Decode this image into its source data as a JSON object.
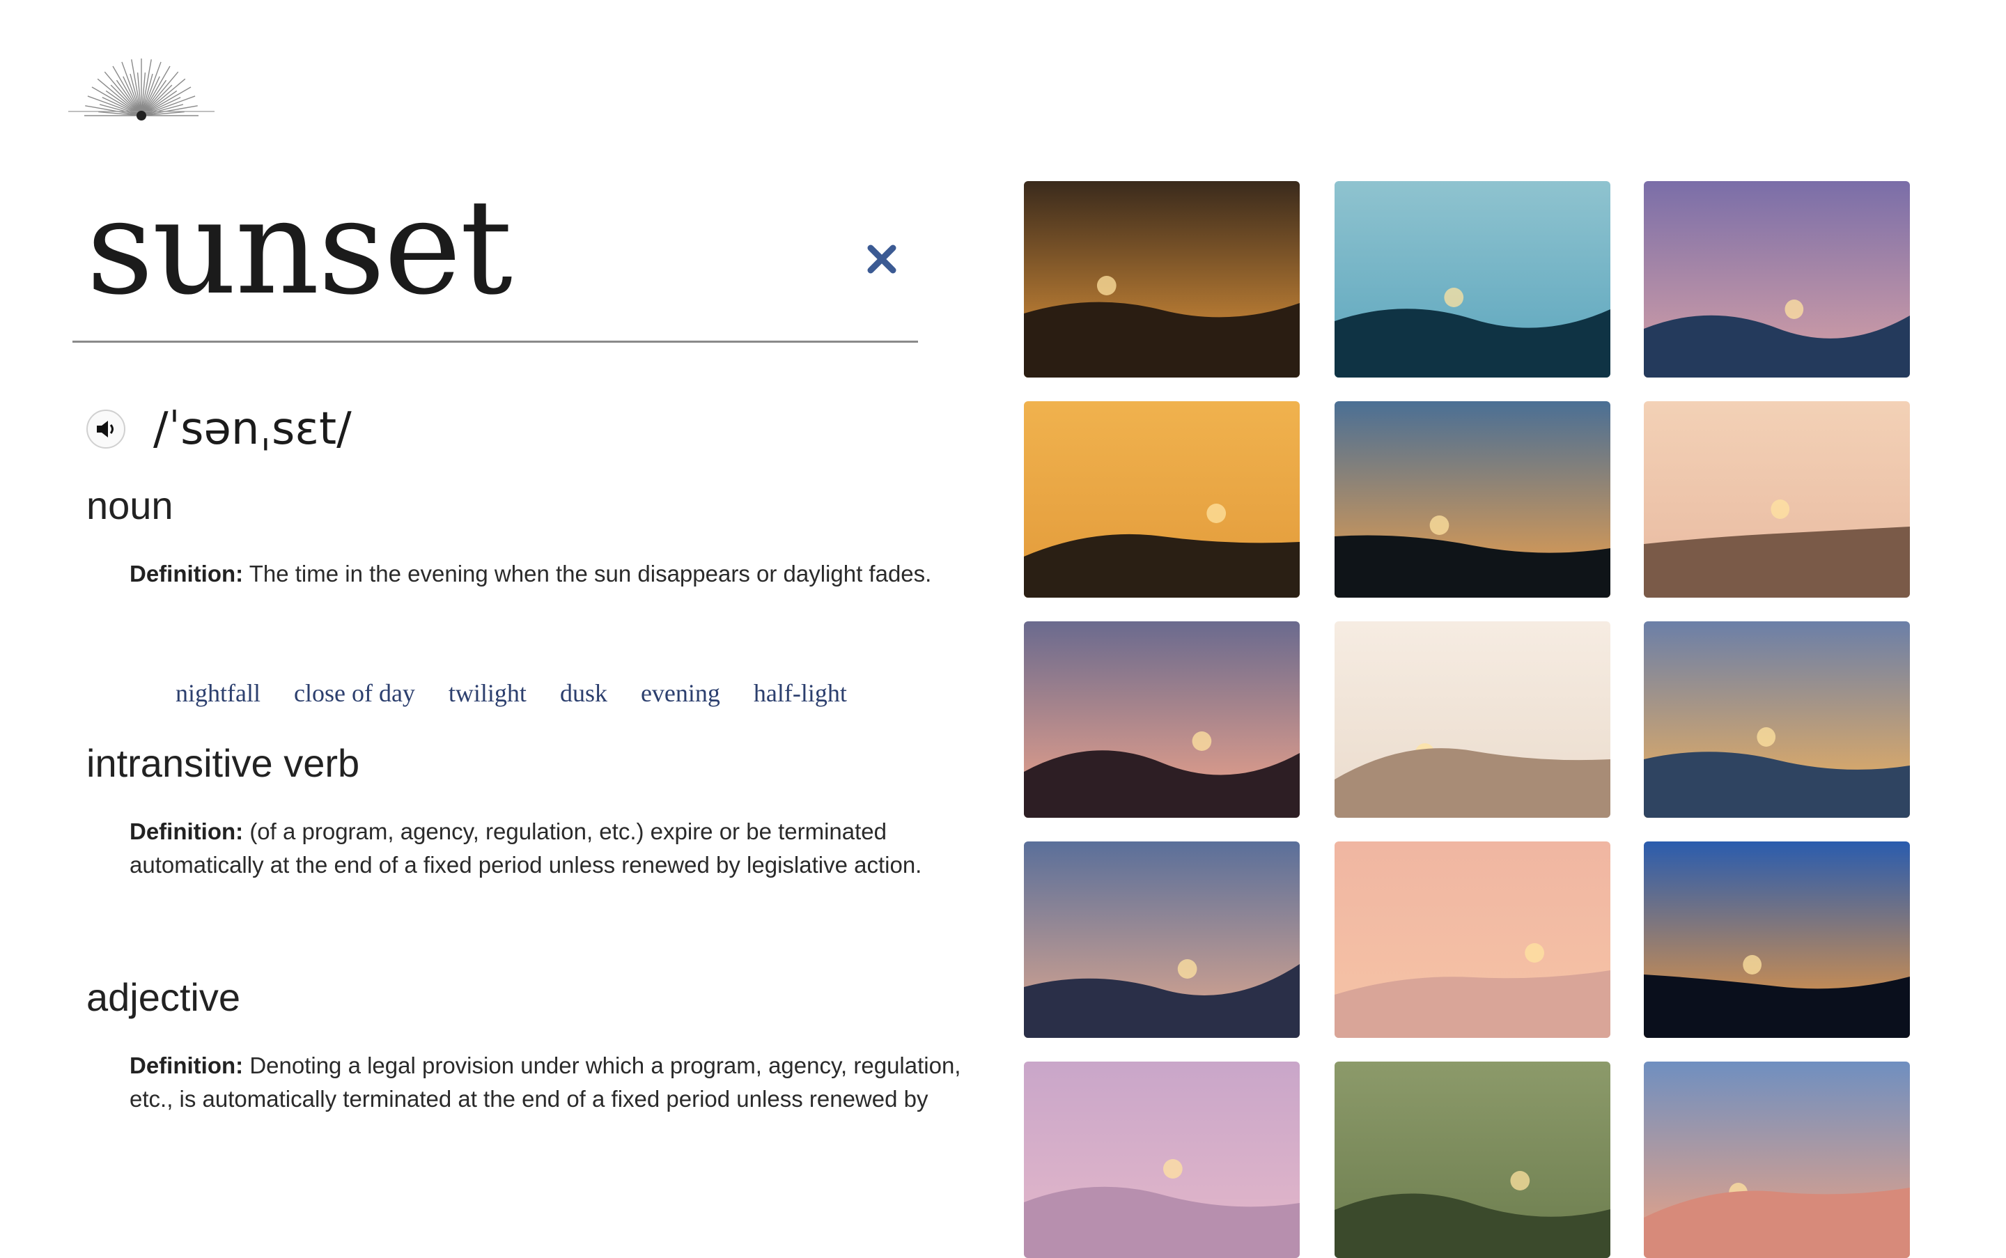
{
  "logo": {
    "icon": "sunburst-icon"
  },
  "search": {
    "term": "sunset",
    "clear_icon": "close-icon"
  },
  "pronunciation": {
    "icon": "speaker-icon",
    "phonetic": "/ˈsənˌsɛt/"
  },
  "senses": [
    {
      "part_of_speech": "noun",
      "definition_label": "Definition:",
      "definition": "The time in the evening when the sun disappears or daylight fades.",
      "synonyms": [
        "nightfall",
        "close of day",
        "twilight",
        "dusk",
        "evening",
        "half-light"
      ]
    },
    {
      "part_of_speech": "intransitive verb",
      "definition_label": "Definition:",
      "definition_line1": "(of a program, agency, regulation, etc.) expire or be terminated",
      "definition_line2": "automatically at the end of a fixed period unless renewed by legislative action."
    },
    {
      "part_of_speech": "adjective",
      "definition_label": "Definition:",
      "definition_line1": "Denoting a legal provision under which a program, agency, regulation,",
      "definition_line2": "etc., is automatically terminated at the end of a fixed period unless renewed by"
    }
  ],
  "images": [
    {
      "name": "splash-silhouette",
      "sky_top": "#3a2a1c",
      "sky_bottom": "#e89a3c",
      "ground": "#2a1d12"
    },
    {
      "name": "misty-mountain",
      "sky_top": "#8fc3cf",
      "sky_bottom": "#5ba5bd",
      "ground": "#0f3344"
    },
    {
      "name": "purple-ocean-clouds",
      "sky_top": "#7a6ea8",
      "sky_bottom": "#d9a2a6",
      "ground": "#243a5c"
    },
    {
      "name": "golden-hills",
      "sky_top": "#f0b24e",
      "sky_bottom": "#e29a3a",
      "ground": "#2a1f14"
    },
    {
      "name": "beach-palms-orange",
      "sky_top": "#4a6f95",
      "sky_bottom": "#f0a14a",
      "ground": "#0f1418"
    },
    {
      "name": "coastal-town",
      "sky_top": "#f3d1b6",
      "sky_bottom": "#e8b9a0",
      "ground": "#7a5a48"
    },
    {
      "name": "tree-on-cliff",
      "sky_top": "#6a6a8e",
      "sky_bottom": "#f2a58a",
      "ground": "#2d1e24"
    },
    {
      "name": "taj-mahal",
      "sky_top": "#f6ece2",
      "sky_bottom": "#eadbcc",
      "ground": "#a88c76"
    },
    {
      "name": "palms-twilight-beach",
      "sky_top": "#6b7fa8",
      "sky_bottom": "#f5b35a",
      "ground": "#2f4461"
    },
    {
      "name": "horse-rider-clouds",
      "sky_top": "#5a6f9a",
      "sky_bottom": "#e2a98e",
      "ground": "#2a2f48"
    },
    {
      "name": "pink-cloud-beach",
      "sky_top": "#f0b6a2",
      "sky_bottom": "#f6c4a6",
      "ground": "#d9a598"
    },
    {
      "name": "palm-silhouettes-blue",
      "sky_top": "#2a5cae",
      "sky_bottom": "#f39a3a",
      "ground": "#0a0f1c"
    },
    {
      "name": "violet-sky",
      "sky_top": "#c9a6c9",
      "sky_bottom": "#e5b8c9",
      "ground": "#b78fae"
    },
    {
      "name": "green-mountains",
      "sky_top": "#8c9a6a",
      "sky_bottom": "#6c7d4e",
      "ground": "#3b4a2c"
    },
    {
      "name": "streaky-clouds",
      "sky_top": "#6f8fc0",
      "sky_bottom": "#f0a482",
      "ground": "#d78a7a"
    }
  ]
}
